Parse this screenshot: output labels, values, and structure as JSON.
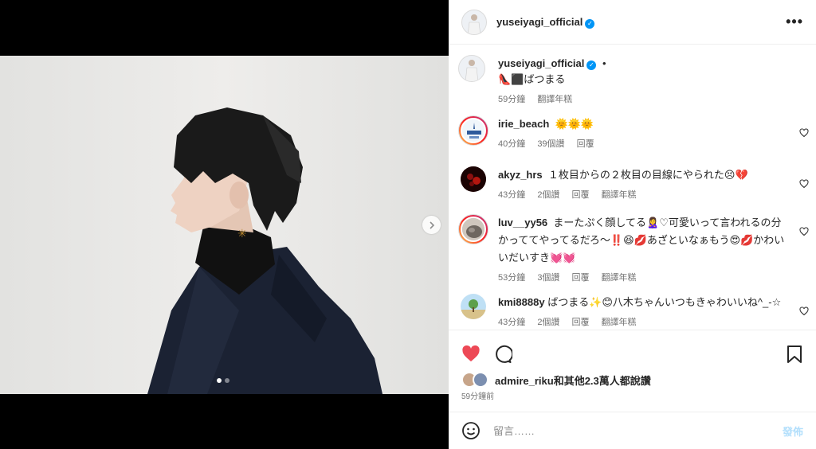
{
  "post": {
    "username": "yuseiyagi_official",
    "more_icon": "more-horizontal-icon"
  },
  "caption": {
    "username": "yuseiyagi_official",
    "separator": "•",
    "text": "👠⬛ばつまる",
    "time": "59分鐘",
    "translate": "翻譯年糕"
  },
  "comments": [
    {
      "username": "irie_beach",
      "text": "🌞🌞🌞",
      "time": "40分鐘",
      "likes": "39個讚",
      "reply": "回覆",
      "translate": ""
    },
    {
      "username": "akyz_hrs",
      "text": "１枚目からの２枚目の目線にやられた😣💔",
      "time": "43分鐘",
      "likes": "2個讚",
      "reply": "回覆",
      "translate": "翻譯年糕"
    },
    {
      "username": "luv__yy56",
      "text": "まーたぷく顔してる🙎‍♀️♡可愛いって言われるの分かっててやってるだろ～‼️😆💋あざといなぁもう😍💋かわいいだいすき💓💓",
      "time": "53分鐘",
      "likes": "3個讚",
      "reply": "回覆",
      "translate": "翻譯年糕"
    },
    {
      "username": "kmi8888y",
      "text": "ばつまる✨😊八木ちゃんいつもきゃわいいね^_-☆",
      "time": "43分鐘",
      "likes": "2個讚",
      "reply": "回覆",
      "translate": "翻譯年糕"
    }
  ],
  "likes": {
    "text": "admire_riku和其他2.3萬人都說讚",
    "time": "59分鐘前"
  },
  "add_comment": {
    "placeholder": "留言……",
    "post_label": "發佈"
  },
  "colors": {
    "like_red": "#ed4956",
    "verified_blue": "#0095f6",
    "post_disabled": "#b2dffc"
  }
}
